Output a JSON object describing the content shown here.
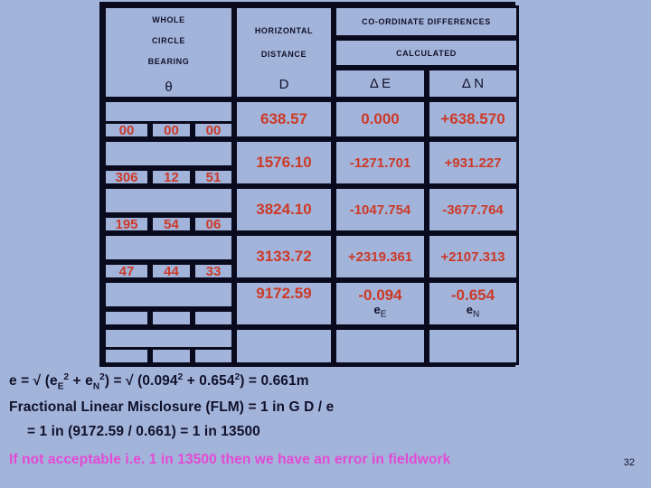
{
  "slide": {
    "page_number": "32",
    "background_color": "#a3b4db",
    "value_color": "#cc3a28",
    "warning_color": "#e24ad4",
    "border_color": "#0a0a1e"
  },
  "table": {
    "headers": {
      "wcb_line1": "WHOLE",
      "wcb_line2": "CIRCLE",
      "wcb_line3": "BEARING",
      "wcb_symbol": "θ",
      "dist_line1": "HORIZONTAL",
      "dist_line2": "DISTANCE",
      "dist_symbol": "D",
      "coord_group": "CO-ORDINATE DIFFERENCES",
      "calculated": "CALCULATED",
      "delta_e": "Δ E",
      "delta_n": "Δ N"
    },
    "rows": [
      {
        "deg": "00",
        "min": "00",
        "sec": "00",
        "distance": "638.57",
        "delta_e": "0.000",
        "delta_n": "+638.570"
      },
      {
        "deg": "306",
        "min": "12",
        "sec": "51",
        "distance": "1576.10",
        "delta_e": "-1271.701",
        "delta_n": "+931.227"
      },
      {
        "deg": "195",
        "min": "54",
        "sec": "06",
        "distance": "3824.10",
        "delta_e": "-1047.754",
        "delta_n": "-3677.764"
      },
      {
        "deg": "47",
        "min": "44",
        "sec": "33",
        "distance": "3133.72",
        "delta_e": "+2319.361",
        "delta_n": "+2107.313"
      }
    ],
    "totals": {
      "distance_sum": "9172.59",
      "error_e_value": "-0.094",
      "error_n_value": "-0.654",
      "error_e_label_main": "e",
      "error_e_label_sub": "E",
      "error_n_label_main": "e",
      "error_n_label_sub": "N"
    }
  },
  "notes": {
    "line1_html": "e = √ (e<sub>E</sub><sup>2</sup> + e<sub>N</sub><sup>2</sup>)  = √ (0.094<sup>2</sup> + 0.654<sup>2</sup>)  = 0.661m",
    "line1_text": "e = √ (eE2 + eN2)  = √ (0.0942 + 0.6542)  = 0.661m",
    "line2": "Fractional Linear Misclosure (FLM)  =  1 in G D / e",
    "line3": "= 1 in (9172.59 / 0.661) = 1 in 13500",
    "line4": "If not acceptable i.e. 1 in 13500 then we have an error in fieldwork"
  }
}
